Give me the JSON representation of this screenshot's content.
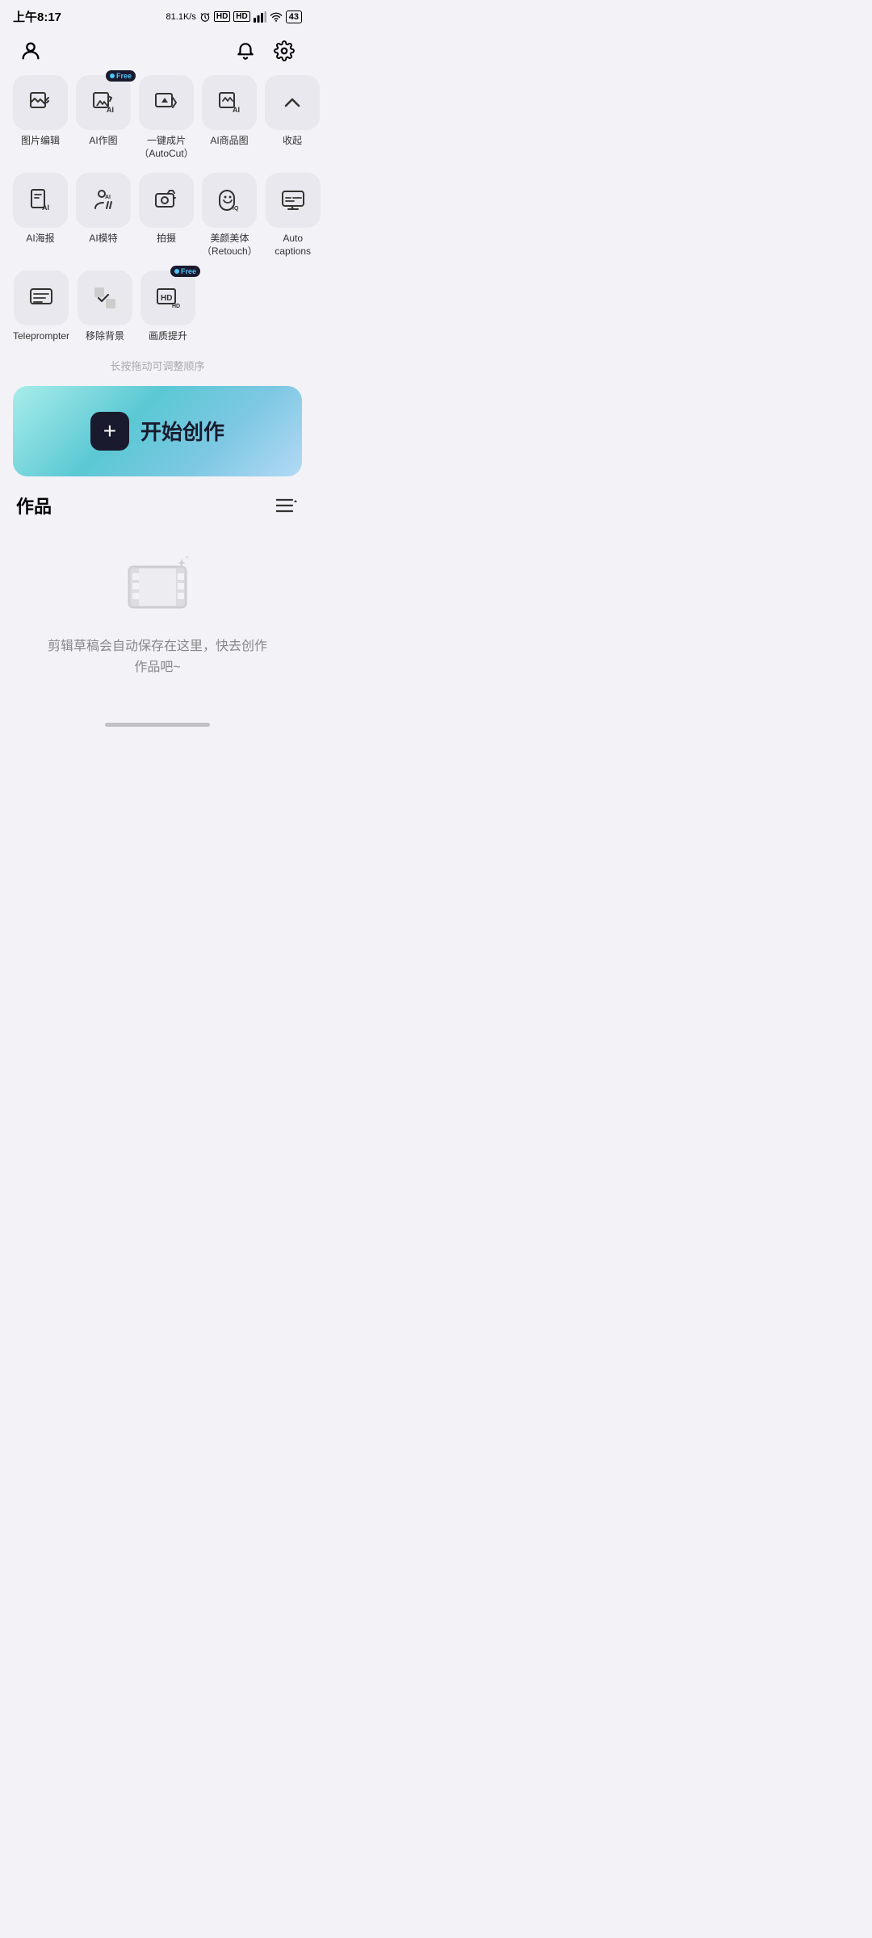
{
  "statusBar": {
    "time": "上午8:17",
    "speed": "81.1K/s",
    "batteryLevel": "43"
  },
  "topBar": {
    "profileIcon": "user-icon",
    "notificationIcon": "bell-icon",
    "settingsIcon": "settings-icon"
  },
  "toolsRows": [
    {
      "row": 1,
      "items": [
        {
          "id": "img-edit",
          "label": "图片编辑",
          "badge": null
        },
        {
          "id": "ai-draw",
          "label": "AI作图",
          "badge": "Free"
        },
        {
          "id": "autocut",
          "label": "一键成片\n（AutoCut）",
          "badge": null
        },
        {
          "id": "ai-product",
          "label": "AI商品图",
          "badge": null
        },
        {
          "id": "collapse",
          "label": "收起",
          "badge": null
        }
      ]
    },
    {
      "row": 2,
      "items": [
        {
          "id": "ai-poster",
          "label": "AI海报",
          "badge": null
        },
        {
          "id": "ai-model",
          "label": "AI模特",
          "badge": null
        },
        {
          "id": "camera",
          "label": "拍摄",
          "badge": null
        },
        {
          "id": "retouch",
          "label": "美颜美体\n（Retouch）",
          "badge": null
        },
        {
          "id": "auto-captions",
          "label": "Auto captions",
          "badge": null
        }
      ]
    },
    {
      "row": 3,
      "items": [
        {
          "id": "teleprompter",
          "label": "Teleprompter",
          "badge": null
        },
        {
          "id": "remove-bg",
          "label": "移除背景",
          "badge": null
        },
        {
          "id": "hd-enhance",
          "label": "画质提升",
          "badge": "Free"
        }
      ]
    }
  ],
  "dragHint": "长按拖动可调整顺序",
  "createBanner": {
    "plusLabel": "+",
    "label": "开始创作"
  },
  "works": {
    "title": "作品",
    "emptyText": "剪辑草稿会自动保存在这里，快去创作\n作品吧~"
  }
}
